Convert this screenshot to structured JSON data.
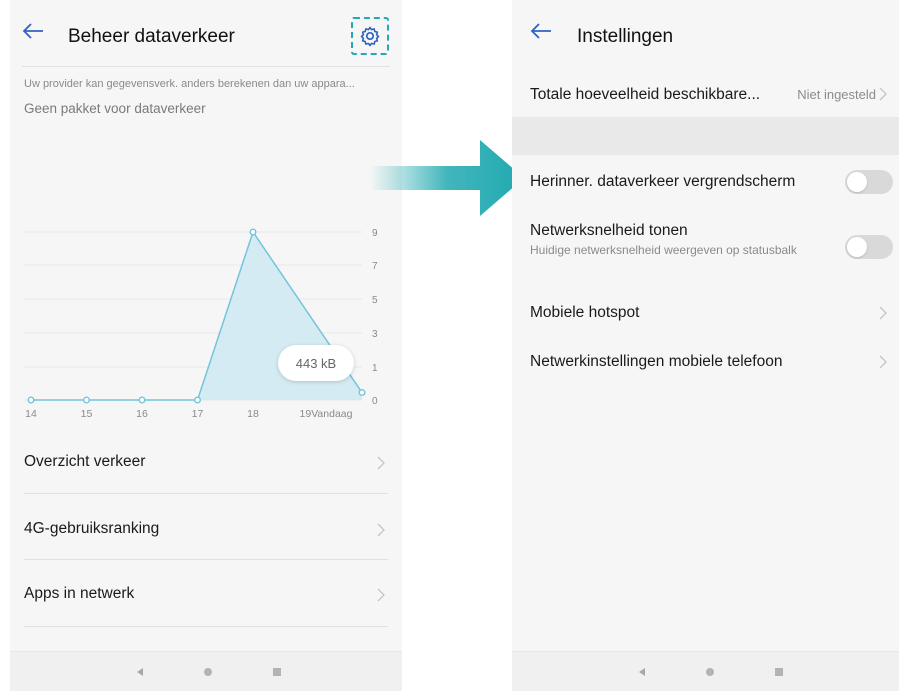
{
  "colors": {
    "accent": "#2aa7b6",
    "back_arrow": "#2f63c2",
    "chart_fill": "#cfe9f2",
    "chart_line": "#74c4dd",
    "toggle_off": "#d9d9d9",
    "arrow_teal": "#20a9b0"
  },
  "left_screen": {
    "title": "Beheer dataverkeer",
    "back_icon": "back-arrow-icon",
    "settings_icon": "gear-icon",
    "notice": "Uw provider kan gegevensverk. anders berekenen dan uw appara...",
    "no_package": "Geen pakket voor dataverkeer",
    "tooltip": "443 kB",
    "list": [
      {
        "label": "Overzicht verkeer"
      },
      {
        "label": "4G-gebruiksranking"
      },
      {
        "label": "Apps in netwerk"
      }
    ]
  },
  "right_screen": {
    "title": "Instellingen",
    "back_icon": "back-arrow-icon",
    "total_label": "Totale hoeveelheid beschikbare...",
    "total_value": "Niet ingesteld",
    "reminder_label": "Herinner. dataverkeer vergrendscherm",
    "reminder_on": false,
    "speed_label": "Netwerksnelheid tonen",
    "speed_sublabel": "Huidige netwerksnelheid weergeven op statusbalk",
    "speed_on": false,
    "hotspot_label": "Mobiele hotspot",
    "network_label": "Netwerkinstellingen mobiele telefoon"
  },
  "navbar": {
    "back_icon": "nav-back-icon",
    "home_icon": "nav-home-icon",
    "recent_icon": "nav-recent-icon"
  },
  "chart_data": {
    "type": "area",
    "categories": [
      "14",
      "15",
      "16",
      "17",
      "18",
      "19Vandaag"
    ],
    "values": [
      0,
      0,
      0,
      0,
      9,
      0.4
    ],
    "y_ticks": [
      "9",
      "7",
      "5",
      "3",
      "1",
      "0"
    ],
    "ylim": [
      0,
      9
    ],
    "grid": true
  }
}
